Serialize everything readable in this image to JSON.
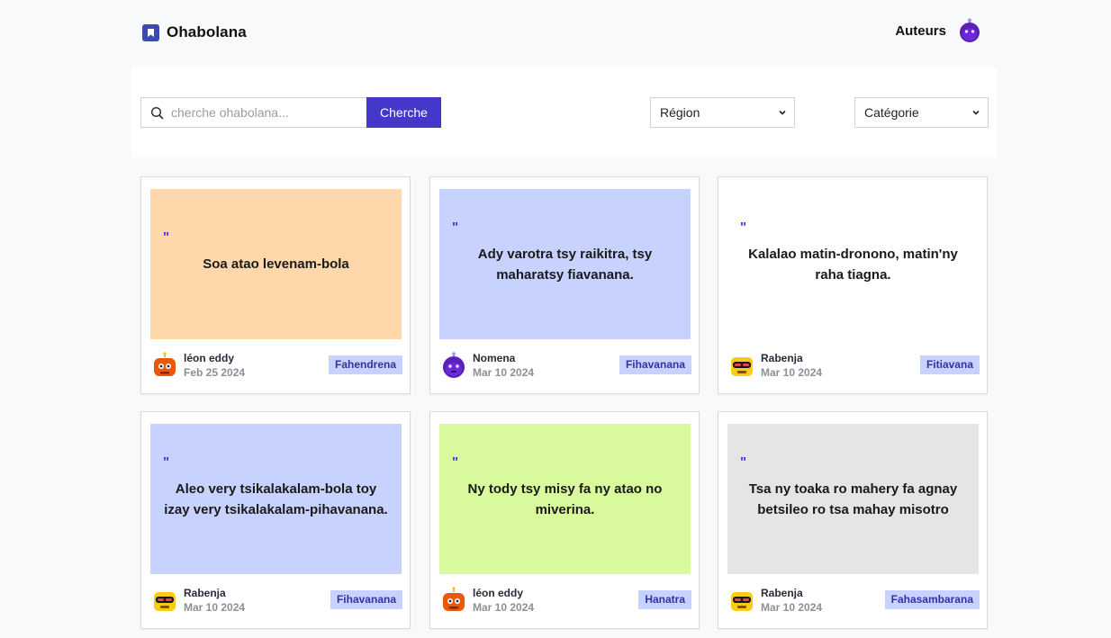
{
  "app": {
    "name": "Ohabolana",
    "nav_authors": "Auteurs"
  },
  "search": {
    "placeholder": "cherche ohabolana...",
    "button": "Cherche"
  },
  "filters": {
    "region": "Région",
    "categorie": "Catégorie"
  },
  "colors": {
    "accent": "#4338ca",
    "tag_bg": "#c7d2fe",
    "orange": "#fed7aa",
    "blue": "#c7d2fe",
    "white": "#ffffff",
    "green": "#d9f99d",
    "gray": "#e5e5e5"
  },
  "cards": [
    {
      "quote_mark": "\"",
      "text": "Soa atao levenam-bola",
      "author": "léon eddy",
      "date": "Feb 25 2024",
      "tag": "Fahendrena",
      "bg": "orange",
      "avatar": "red-robot-avatar"
    },
    {
      "quote_mark": "\"",
      "text": "Ady varotra tsy raikitra, tsy maharatsy fiavanana.",
      "author": "Nomena",
      "date": "Mar 10 2024",
      "tag": "Fihavanana",
      "bg": "blue",
      "avatar": "purple-robot-avatar"
    },
    {
      "quote_mark": "\"",
      "text": "Kalalao matin-dronono, matin'ny raha tiagna.",
      "author": "Rabenja",
      "date": "Mar 10 2024",
      "tag": "Fitiavana",
      "bg": "white",
      "avatar": "yellow-robot-avatar"
    },
    {
      "quote_mark": "\"",
      "text": "Aleo very tsikalakalam-bola toy izay very tsikalakalam-pihavanana.",
      "author": "Rabenja",
      "date": "Mar 10 2024",
      "tag": "Fihavanana",
      "bg": "blue",
      "avatar": "yellow-robot-avatar"
    },
    {
      "quote_mark": "\"",
      "text": "Ny tody tsy misy fa ny atao no miverina.",
      "author": "léon eddy",
      "date": "Mar 10 2024",
      "tag": "Hanatra",
      "bg": "green",
      "avatar": "red-robot-avatar"
    },
    {
      "quote_mark": "\"",
      "text": "Tsa ny toaka ro mahery fa agnay betsileo ro tsa mahay misotro",
      "author": "Rabenja",
      "date": "Mar 10 2024",
      "tag": "Fahasambarana",
      "bg": "gray",
      "avatar": "yellow-robot-avatar"
    }
  ]
}
